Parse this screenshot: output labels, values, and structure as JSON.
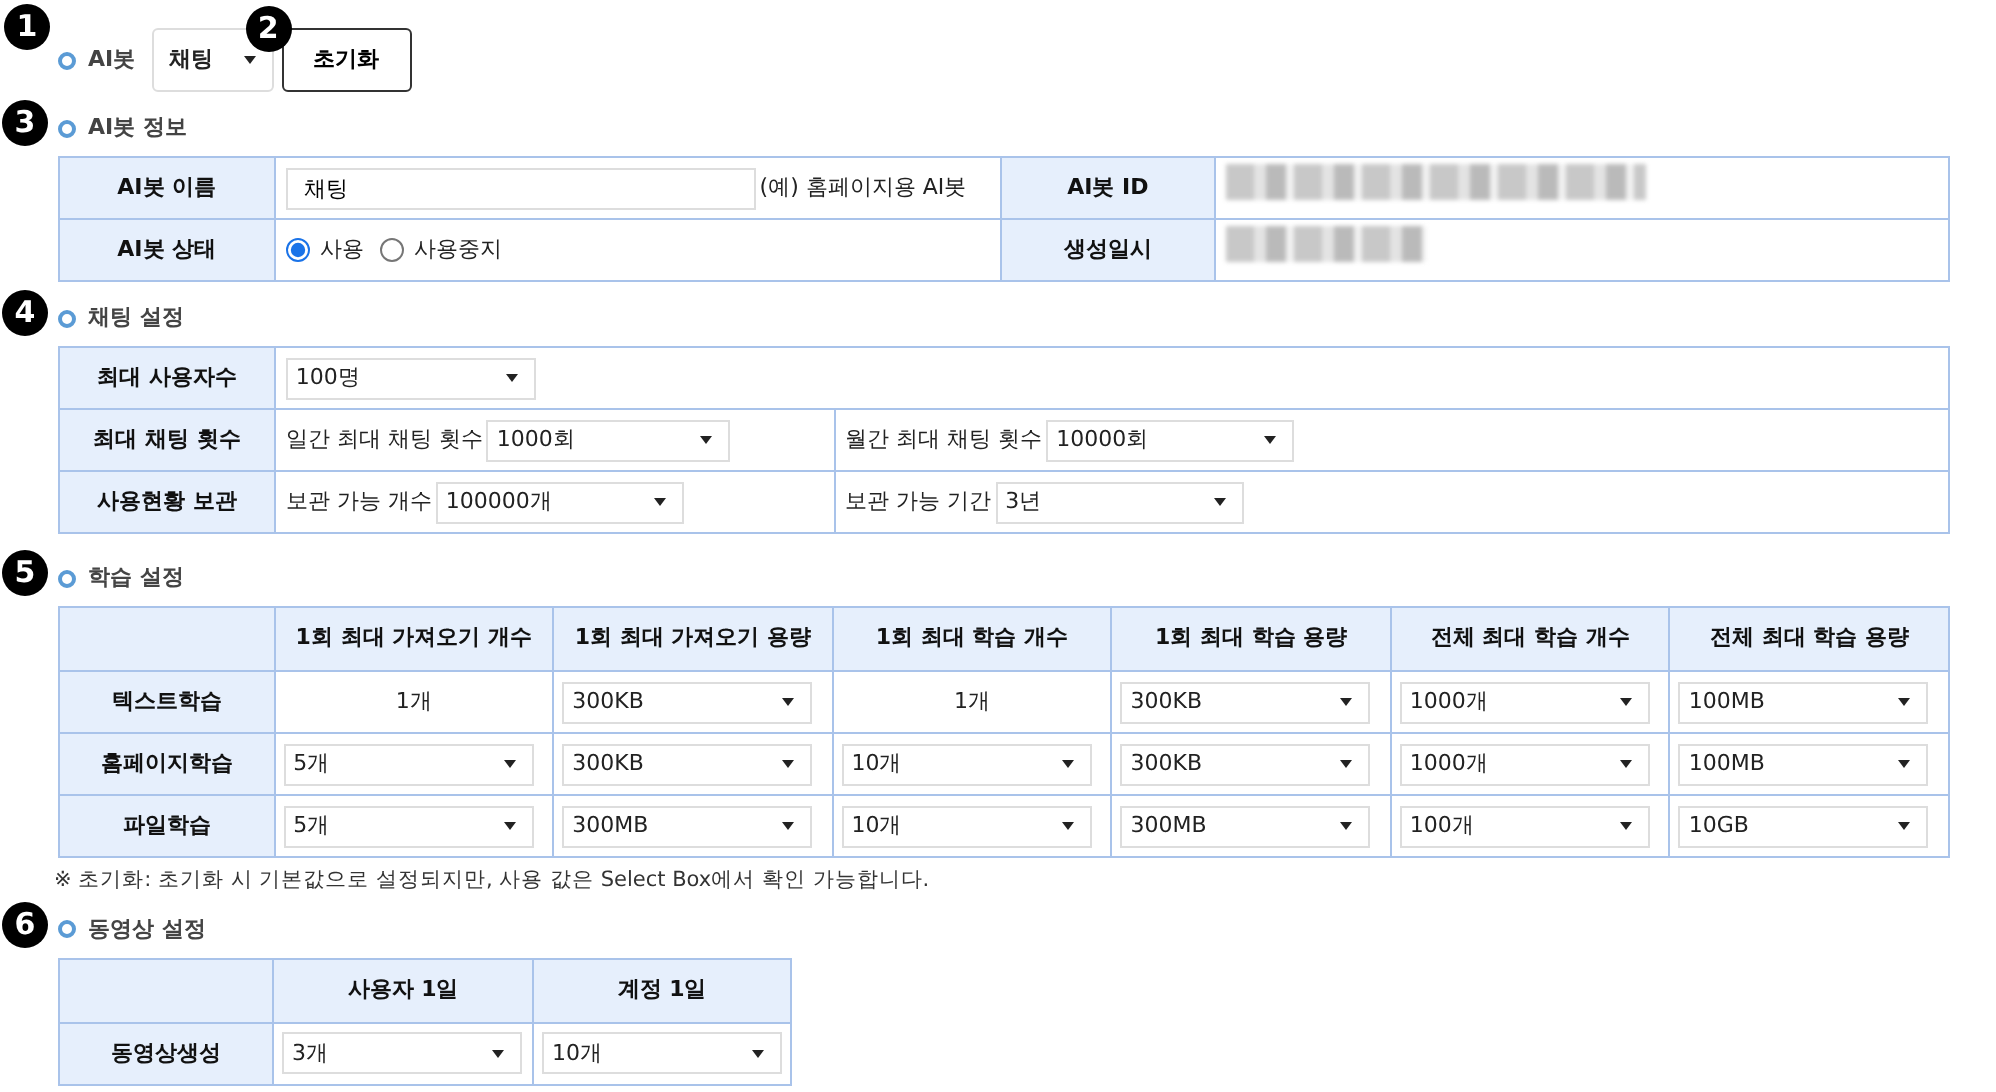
{
  "bot_select": {
    "marker": "1",
    "label": "AI봇",
    "value": "채팅"
  },
  "reset_button": {
    "marker": "2",
    "label": "초기화"
  },
  "bot_info": {
    "marker": "3",
    "title": "AI봇 정보",
    "name_label": "AI봇 이름",
    "name_value": "채팅",
    "name_hint": "(예) 홈페이지용 AI봇",
    "id_label": "AI봇 ID",
    "id_value": {
      "kind": "redacted"
    },
    "status_label": "AI봇 상태",
    "status_options": [
      {
        "label": "사용",
        "selected": true
      },
      {
        "label": "사용중지",
        "selected": false
      }
    ],
    "created_label": "생성일시",
    "created_value": {
      "kind": "redacted"
    }
  },
  "chat_settings": {
    "marker": "4",
    "title": "채팅 설정",
    "rows": [
      {
        "label": "최대 사용자수",
        "fields": [
          {
            "value": "100명"
          }
        ]
      },
      {
        "label": "최대 채팅 횟수",
        "fields": [
          {
            "label": "일간 최대 채팅 횟수",
            "value": "1000회"
          },
          {
            "label": "월간 최대 채팅 횟수",
            "value": "10000회"
          }
        ]
      },
      {
        "label": "사용현황 보관",
        "fields": [
          {
            "label": "보관 가능 개수",
            "value": "100000개"
          },
          {
            "label": "보관 가능 기간",
            "value": "3년"
          }
        ]
      }
    ]
  },
  "learning": {
    "marker": "5",
    "title": "학습 설정",
    "columns": [
      "1회 최대 가져오기 개수",
      "1회 최대 가져오기 용량",
      "1회 최대 학습 개수",
      "1회 최대 학습 용량",
      "전체 최대 학습 개수",
      "전체 최대 학습 용량"
    ],
    "rows": [
      {
        "label": "텍스트학습",
        "cells": [
          {
            "kind": "text",
            "value": "1개"
          },
          {
            "kind": "select",
            "value": "300KB"
          },
          {
            "kind": "text",
            "value": "1개"
          },
          {
            "kind": "select",
            "value": "300KB"
          },
          {
            "kind": "select",
            "value": "1000개"
          },
          {
            "kind": "select",
            "value": "100MB"
          }
        ]
      },
      {
        "label": "홈페이지학습",
        "cells": [
          {
            "kind": "select",
            "value": "5개"
          },
          {
            "kind": "select",
            "value": "300KB"
          },
          {
            "kind": "select",
            "value": "10개"
          },
          {
            "kind": "select",
            "value": "300KB"
          },
          {
            "kind": "select",
            "value": "1000개"
          },
          {
            "kind": "select",
            "value": "100MB"
          }
        ]
      },
      {
        "label": "파일학습",
        "cells": [
          {
            "kind": "select",
            "value": "5개"
          },
          {
            "kind": "select",
            "value": "300MB"
          },
          {
            "kind": "select",
            "value": "10개"
          },
          {
            "kind": "select",
            "value": "300MB"
          },
          {
            "kind": "select",
            "value": "100개"
          },
          {
            "kind": "select",
            "value": "10GB"
          }
        ]
      }
    ],
    "note": "※ 초기화: 초기화 시 기본값으로 설정되지만, 사용 값은 Select Box에서 확인 가능합니다."
  },
  "video": {
    "marker": "6",
    "title": "동영상 설정",
    "columns": [
      "사용자 1일",
      "계정 1일"
    ],
    "rows": [
      {
        "label": "동영상생성",
        "cells": [
          {
            "kind": "select",
            "value": "3개"
          },
          {
            "kind": "select",
            "value": "10개"
          }
        ]
      }
    ]
  }
}
